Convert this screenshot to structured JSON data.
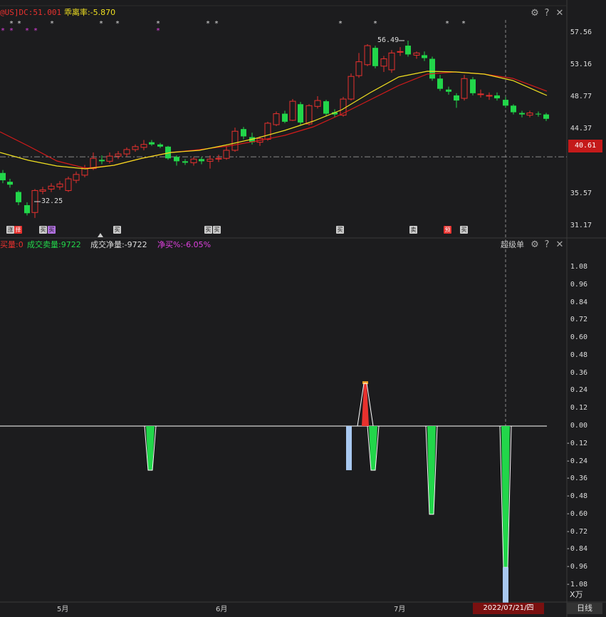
{
  "top_panel": {
    "indicator_label": "@US]DC:51.001",
    "deviation_label": "乖离率:-5.870",
    "high_label": "56.49",
    "low_label": "32.25",
    "current_price": "40.61",
    "price_ticks": [
      "57.56",
      "53.16",
      "48.77",
      "44.37",
      "39.97",
      "35.57",
      "31.17"
    ]
  },
  "bottom_panel": {
    "vol_label": "买量:0",
    "sell_label": "成交卖量:9722",
    "net_label": "成交净量:-9722",
    "netpct_label": "净买%:-6.05%",
    "panel_name": "超级单",
    "unit_label": "X万",
    "ticks": [
      "1.08",
      "0.96",
      "0.84",
      "0.72",
      "0.60",
      "0.48",
      "0.36",
      "0.24",
      "0.12",
      "0.00",
      "-0.12",
      "-0.24",
      "-0.36",
      "-0.48",
      "-0.60",
      "-0.72",
      "-0.84",
      "-0.96",
      "-1.08"
    ]
  },
  "time_axis": {
    "months": [
      "5月",
      "6月",
      "7月"
    ],
    "cursor_date": "2022/07/21/四",
    "period": "日线"
  },
  "signal_marks": [
    "涨",
    "择",
    "买",
    "买",
    "买",
    "买",
    "买",
    "买",
    "卖",
    "预",
    "买"
  ],
  "colors": {
    "up": "#e8312e",
    "down": "#22d64a",
    "ma_yellow": "#f0e020",
    "ma_red": "#d41a1a",
    "net_magenta": "#e040e0",
    "sell_green": "#22d64a",
    "light_blue": "#a8c8f0",
    "price_box": "#c41a1a"
  },
  "icons": [
    "settings-icon",
    "help-icon",
    "close-icon"
  ]
}
